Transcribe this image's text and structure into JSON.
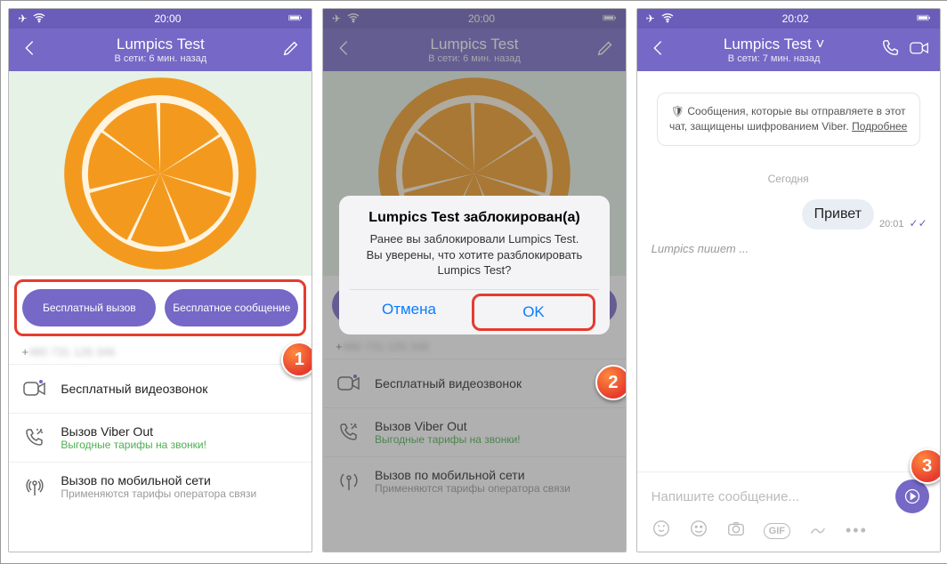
{
  "badges": {
    "one": "1",
    "two": "2",
    "three": "3"
  },
  "screen1": {
    "status": {
      "time": "20:00"
    },
    "header": {
      "title": "Lumpics Test",
      "sub": "В сети: 6 мин. назад"
    },
    "buttons": {
      "call": "Бесплатный вызов",
      "msg": "Бесплатное сообщение"
    },
    "phone_prefix": "+",
    "list": {
      "video": "Бесплатный видеозвонок",
      "viberout": "Вызов Viber Out",
      "viberout_sub": "Выгодные тарифы на звонки!",
      "cellular": "Вызов по мобильной сети",
      "cellular_sub": "Применяются тарифы оператора связи"
    }
  },
  "screen2": {
    "status": {
      "time": "20:00"
    },
    "header": {
      "title": "Lumpics Test",
      "sub": "В сети: 6 мин. назад"
    },
    "alert": {
      "title": "Lumpics Test заблокирован(а)",
      "body": "Ранее вы заблокировали Lumpics Test.\nВы уверены, что хотите разблокировать Lumpics Test?",
      "cancel": "Отмена",
      "ok": "OK"
    },
    "list": {
      "video": "Бесплатный видеозвонок",
      "viberout": "Вызов Viber Out",
      "viberout_sub": "Выгодные тарифы на звонки!",
      "cellular": "Вызов по мобильной сети",
      "cellular_sub": "Применяются тарифы оператора связи"
    }
  },
  "screen3": {
    "status": {
      "time": "20:02"
    },
    "header": {
      "title": "Lumpics Test ˅",
      "sub": "В сети: 7 мин. назад"
    },
    "enc_text": "Сообщения, которые вы отправляете в этот чат, защищены шифрованием Viber.",
    "enc_more": "Подробнее",
    "day": "Сегодня",
    "msg": "Привет",
    "msg_time": "20:01",
    "typing": "Lumpics пишет ...",
    "input_placeholder": "Напишите сообщение...",
    "gif": "GIF"
  }
}
